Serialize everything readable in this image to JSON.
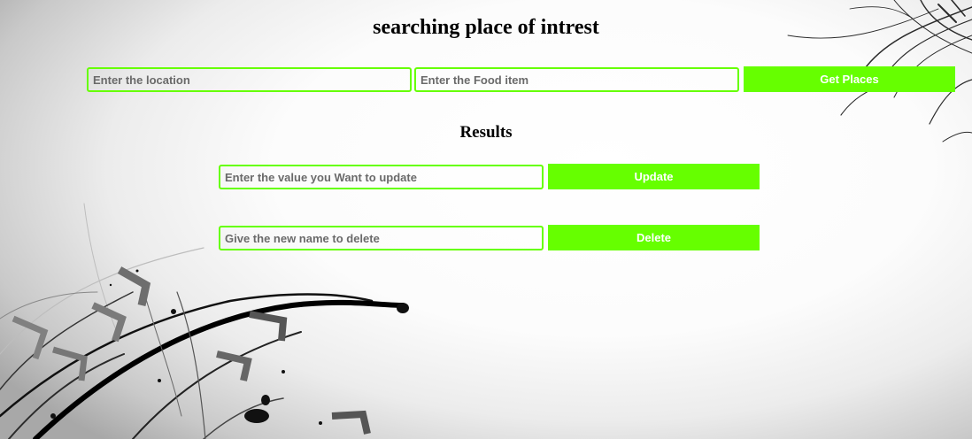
{
  "header": {
    "title": "searching place of intrest"
  },
  "search": {
    "location_placeholder": "Enter the location",
    "food_placeholder": "Enter the Food item",
    "get_places_label": "Get Places"
  },
  "results": {
    "title": "Results"
  },
  "update": {
    "placeholder": "Enter the value you Want to update",
    "button_label": "Update"
  },
  "delete": {
    "placeholder": "Give the new name to delete",
    "button_label": "Delete"
  },
  "theme": {
    "accent": "#66ff00",
    "button_text": "#ffffff",
    "placeholder_text": "#6a6a6a"
  }
}
